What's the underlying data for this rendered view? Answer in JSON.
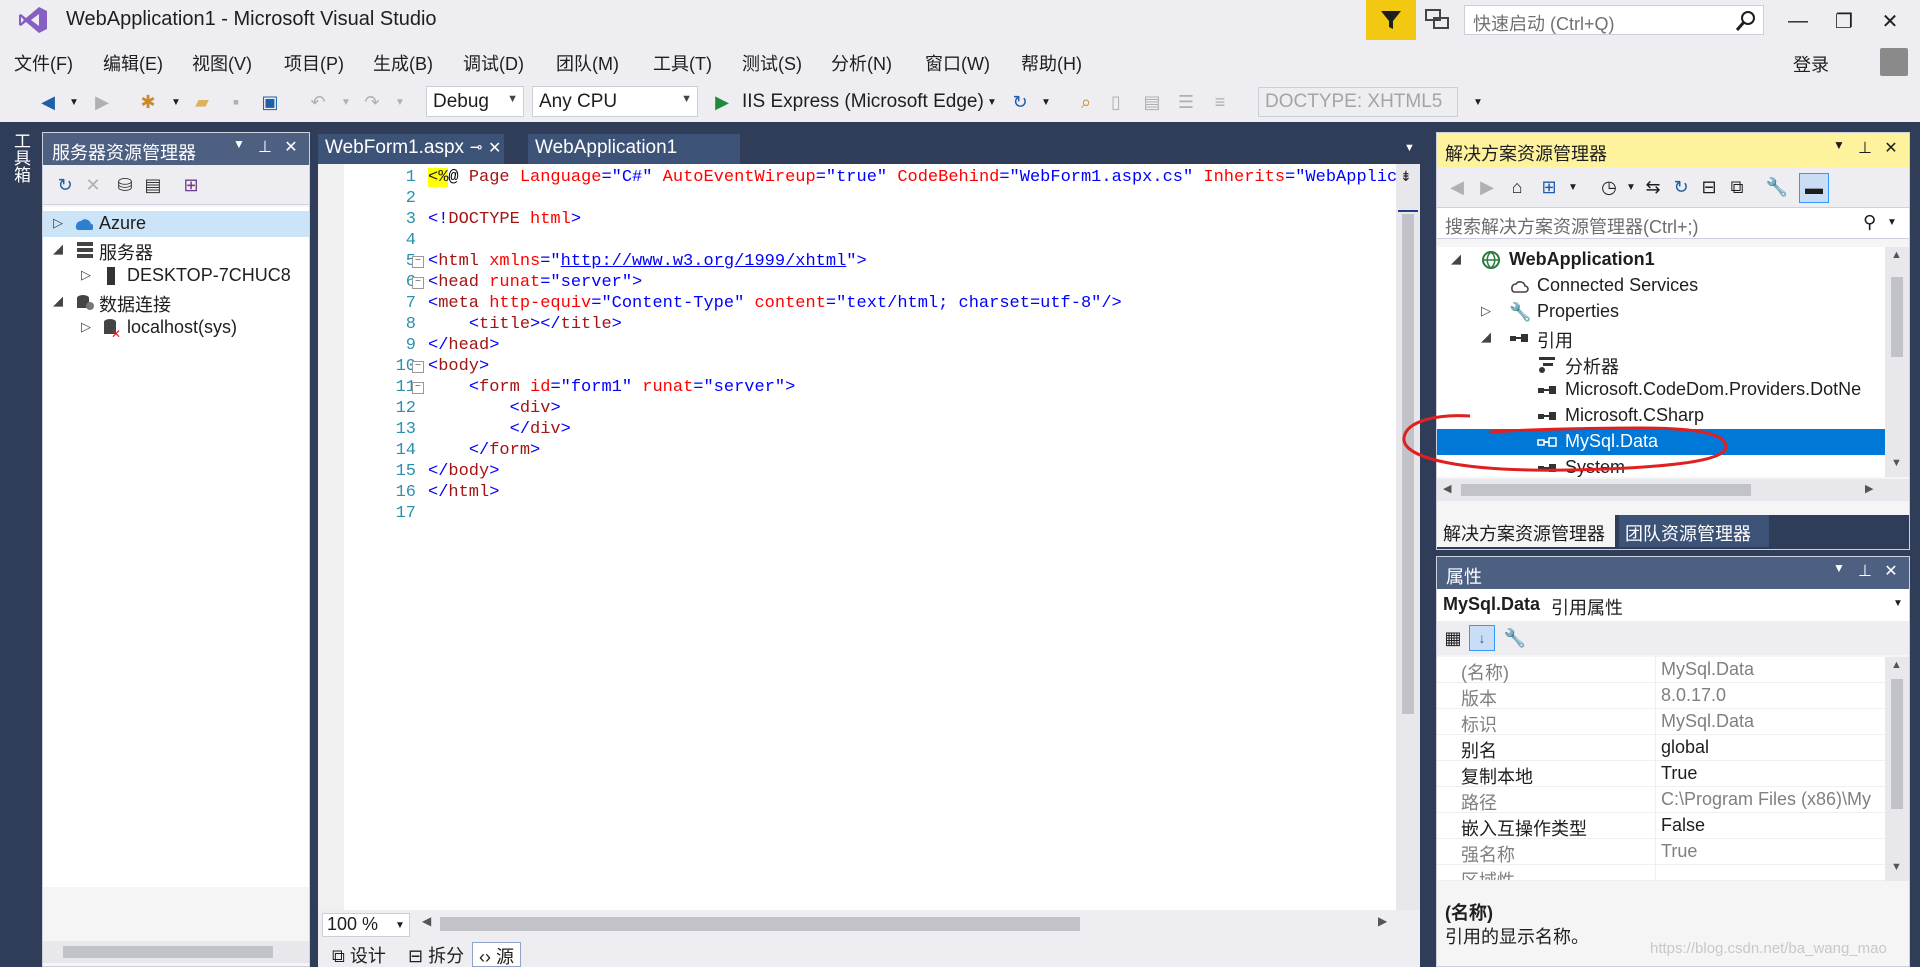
{
  "window": {
    "title": "WebApplication1 - Microsoft Visual Studio",
    "quick_launch_placeholder": "快速启动 (Ctrl+Q)",
    "login": "登录",
    "minimize": "—",
    "restore": "❐",
    "close": "✕"
  },
  "menu": [
    "文件(F)",
    "编辑(E)",
    "视图(V)",
    "项目(P)",
    "生成(B)",
    "调试(D)",
    "团队(M)",
    "工具(T)",
    "测试(S)",
    "分析(N)",
    "窗口(W)",
    "帮助(H)"
  ],
  "toolbar": {
    "config": "Debug",
    "platform": "Any CPU",
    "run_target": "IIS Express (Microsoft Edge)",
    "doctype": "DOCTYPE: XHTML5"
  },
  "toolbox_label": "工具箱",
  "server_explorer": {
    "title": "服务器资源管理器",
    "nodes": [
      "Azure",
      "服务器",
      "DESKTOP-7CHUC8",
      "数据连接",
      "localhost(sys)"
    ]
  },
  "editor": {
    "tabs": [
      {
        "label": "WebForm1.aspx",
        "pin": "⊸",
        "close": "✕"
      },
      {
        "label": "WebApplication1"
      }
    ],
    "line_numbers": [
      "1",
      "2",
      "3",
      "4",
      "5",
      "6",
      "7",
      "8",
      "9",
      "10",
      "11",
      "12",
      "13",
      "14",
      "15",
      "16",
      "17"
    ],
    "zoom": "100 %",
    "view_tabs": [
      "设计",
      "拆分",
      "源"
    ]
  },
  "solution_explorer": {
    "title": "解决方案资源管理器",
    "search_placeholder": "搜索解决方案资源管理器(Ctrl+;)",
    "nodes": [
      "WebApplication1",
      "Connected Services",
      "Properties",
      "引用",
      "分析器",
      "Microsoft.CodeDom.Providers.DotNe",
      "Microsoft.CSharp",
      "MySql.Data",
      "System"
    ],
    "selected": "MySql.Data",
    "tabs": [
      "解决方案资源管理器",
      "团队资源管理器"
    ]
  },
  "properties": {
    "title": "属性",
    "object_name": "MySql.Data",
    "object_type": "引用属性",
    "rows": [
      {
        "name": "(名称)",
        "value": "MySql.Data",
        "muted": true
      },
      {
        "name": "版本",
        "value": "8.0.17.0",
        "muted": true
      },
      {
        "name": "标识",
        "value": "MySql.Data",
        "muted": true
      },
      {
        "name": "别名",
        "value": "global",
        "muted": false
      },
      {
        "name": "复制本地",
        "value": "True",
        "muted": false
      },
      {
        "name": "路径",
        "value": "C:\\Program Files (x86)\\My",
        "muted": true
      },
      {
        "name": "嵌入互操作类型",
        "value": "False",
        "muted": false
      },
      {
        "name": "强名称",
        "value": "True",
        "muted": true
      },
      {
        "name": "区域性",
        "value": "",
        "muted": true
      }
    ],
    "desc_title": "(名称)",
    "desc_text": "引用的显示名称。"
  },
  "watermark": "https://blog.csdn.net/ba_wang_mao",
  "colors": {
    "accent": "#007acc",
    "frame": "#2f3d58",
    "active_header": "#fff29d",
    "annotation": "#e02020"
  }
}
